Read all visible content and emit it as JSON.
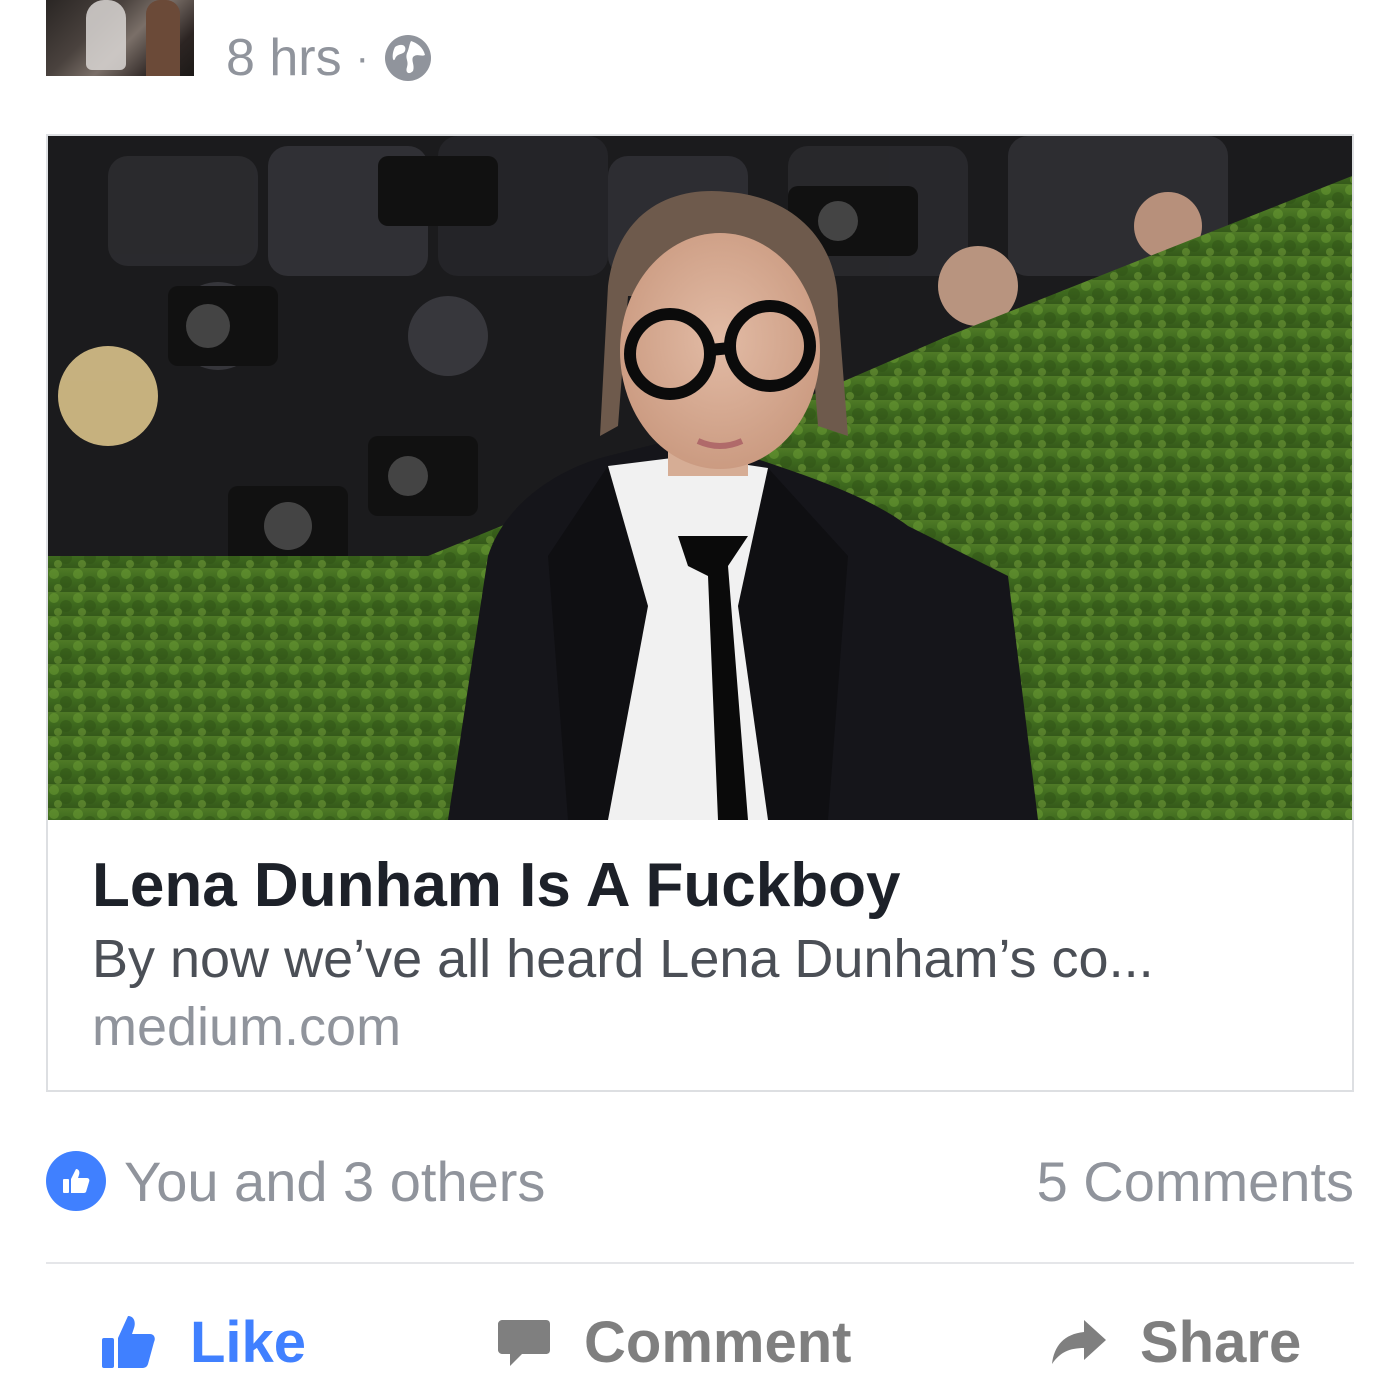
{
  "post": {
    "time": "8 hrs",
    "separator": "·",
    "privacy_icon": "globe-icon"
  },
  "link_card": {
    "image_icon": "article-photo",
    "title": "Lena Dunham Is A Fuckboy",
    "description": "By now we’ve all heard Lena Dunham’s co...",
    "domain": "medium.com"
  },
  "stats": {
    "reactions": "You and 3 others",
    "comments": "5 Comments"
  },
  "actions": {
    "like": "Like",
    "comment": "Comment",
    "share": "Share"
  },
  "colors": {
    "accent": "#4080ff",
    "meta_text": "#90949c",
    "action_text": "#7f7f7f",
    "title_text": "#1d2129"
  }
}
